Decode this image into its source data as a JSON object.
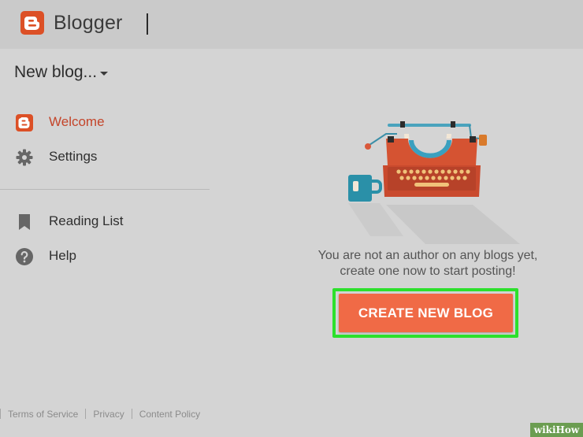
{
  "header": {
    "app_title": "Blogger",
    "logo_icon": "blogger-logo-icon",
    "brand_color": "#dc5026"
  },
  "sidebar": {
    "blog_selector": "New blog...",
    "items": [
      {
        "label": "Welcome",
        "icon": "blogger-icon",
        "active": true
      },
      {
        "label": "Settings",
        "icon": "gear-icon",
        "active": false
      },
      {
        "label": "Reading List",
        "icon": "bookmark-icon",
        "active": false
      },
      {
        "label": "Help",
        "icon": "help-icon",
        "active": false
      }
    ],
    "active_color": "#c4452a"
  },
  "main": {
    "illustration_icon": "typewriter-illustration",
    "message_line1": "You are not an author on any blogs yet,",
    "message_line2": "create one now to start posting!",
    "cta_label": "CREATE NEW BLOG",
    "cta_color": "#f06a46",
    "highlight_color": "#2ce02c"
  },
  "footer": {
    "links": [
      "Terms of Service",
      "Privacy",
      "Content Policy"
    ]
  },
  "watermark": {
    "text": "wikiHow"
  }
}
